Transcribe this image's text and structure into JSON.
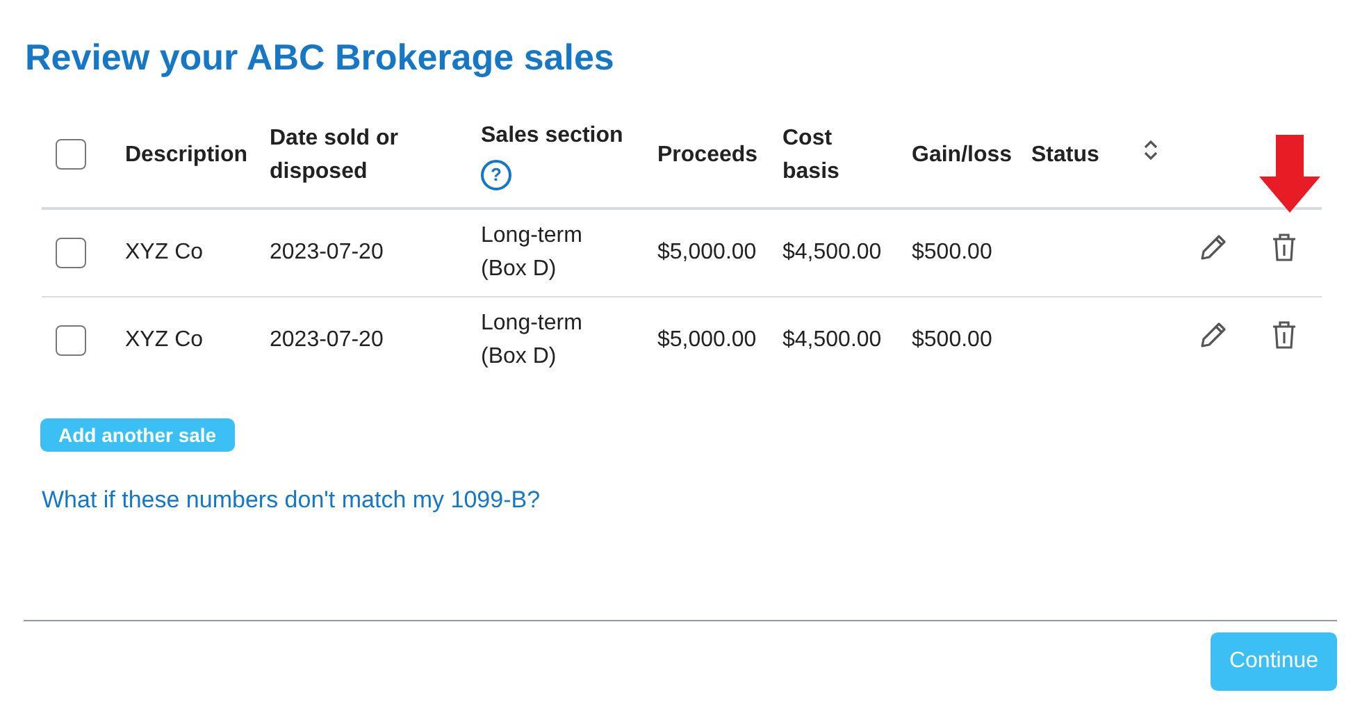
{
  "title": "Review your ABC Brokerage sales",
  "select_all": {
    "checked": false
  },
  "columns": [
    {
      "label": "Description"
    },
    {
      "label": "Date sold or disposed"
    },
    {
      "label": "Sales section",
      "help_icon": "?"
    },
    {
      "label": "Proceeds"
    },
    {
      "label": "Cost basis"
    },
    {
      "label": "Gain/loss"
    },
    {
      "label": "Status"
    }
  ],
  "rows": [
    {
      "checked": false,
      "cells": [
        "XYZ Co",
        "2023-07-20",
        "Long-term (Box D)",
        "$5,000.00",
        "$4,500.00",
        "$500.00"
      ]
    },
    {
      "checked": false,
      "cells": [
        "XYZ Co",
        "2023-07-20",
        "Long-term (Box D)",
        "$5,000.00",
        "$4,500.00",
        "$500.00"
      ]
    }
  ],
  "add_button": "Add another sale",
  "help_link": "What if these numbers don't match my 1099-B?",
  "continue_button": "Continue"
}
